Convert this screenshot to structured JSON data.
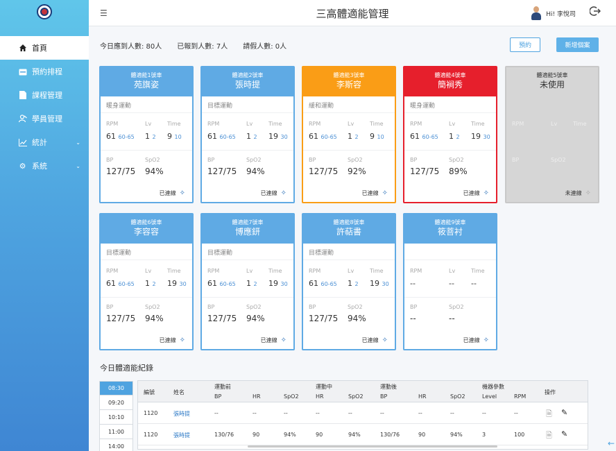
{
  "app": {
    "title": "三高體適能管理"
  },
  "user": {
    "greeting": "Hi! 李悅司"
  },
  "sidebar": {
    "items": [
      {
        "label": "首頁",
        "icon": "home-icon"
      },
      {
        "label": "預約排程",
        "icon": "calendar-icon"
      },
      {
        "label": "課程管理",
        "icon": "document-icon"
      },
      {
        "label": "學員管理",
        "icon": "users-icon"
      },
      {
        "label": "統計",
        "icon": "chart-icon"
      },
      {
        "label": "系統",
        "icon": "gear-icon"
      }
    ]
  },
  "summary": {
    "due": "今日應到人數: 80人",
    "arrived": "已報到人數: 7人",
    "leave": "請假人數: 0人"
  },
  "buttons": {
    "reserve": "預約",
    "new_record": "新增個案"
  },
  "labels": {
    "rpm": "RPM",
    "lv": "Lv",
    "time": "Time",
    "bp": "BP",
    "spo2": "SpO2"
  },
  "cards": [
    {
      "bike": "體適能1號車",
      "name": "苑旗姿",
      "mode": "暖身運動",
      "rpm": "61",
      "rpm_target": "60-65",
      "lv": "1",
      "lv_target": "2",
      "time": "9",
      "time_target": "10",
      "bp": "127/75",
      "spo2": "94%",
      "status": "已連線",
      "color": "blue"
    },
    {
      "bike": "體適能2號車",
      "name": "張時提",
      "mode": "目標運動",
      "rpm": "61",
      "rpm_target": "60-65",
      "lv": "1",
      "lv_target": "2",
      "time": "19",
      "time_target": "30",
      "bp": "127/75",
      "spo2": "94%",
      "status": "已連線",
      "color": "blue"
    },
    {
      "bike": "體適能3號車",
      "name": "李斯容",
      "mode": "緩和運動",
      "rpm": "61",
      "rpm_target": "60-65",
      "lv": "1",
      "lv_target": "2",
      "time": "9",
      "time_target": "10",
      "bp": "127/75",
      "spo2": "92%",
      "status": "已連線",
      "color": "orange"
    },
    {
      "bike": "體適能4號車",
      "name": "簡裥秀",
      "mode": "暖身運動",
      "rpm": "61",
      "rpm_target": "60-65",
      "lv": "1",
      "lv_target": "2",
      "time": "19",
      "time_target": "30",
      "bp": "127/75",
      "spo2": "89%",
      "status": "已連線",
      "color": "red"
    },
    {
      "bike": "體適能5號車",
      "name": "未使用",
      "mode": "",
      "rpm": "",
      "rpm_target": "",
      "lv": "",
      "lv_target": "",
      "time": "",
      "time_target": "",
      "bp": "",
      "spo2": "",
      "status": "未連線",
      "color": "gray"
    },
    {
      "bike": "體適能6號車",
      "name": "李容容",
      "mode": "目標運動",
      "rpm": "61",
      "rpm_target": "60-65",
      "lv": "1",
      "lv_target": "2",
      "time": "19",
      "time_target": "30",
      "bp": "127/75",
      "spo2": "94%",
      "status": "已連線",
      "color": "blue"
    },
    {
      "bike": "體適能7號車",
      "name": "博應鈃",
      "mode": "目標運動",
      "rpm": "61",
      "rpm_target": "60-65",
      "lv": "1",
      "lv_target": "2",
      "time": "19",
      "time_target": "30",
      "bp": "127/75",
      "spo2": "94%",
      "status": "已連線",
      "color": "blue"
    },
    {
      "bike": "體適能8號車",
      "name": "許萜書",
      "mode": "目標運動",
      "rpm": "61",
      "rpm_target": "60-65",
      "lv": "1",
      "lv_target": "2",
      "time": "19",
      "time_target": "30",
      "bp": "127/75",
      "spo2": "94%",
      "status": "已連線",
      "color": "blue"
    },
    {
      "bike": "體適能9號車",
      "name": "筱菩衬",
      "mode": "",
      "rpm": "--",
      "rpm_target": "",
      "lv": "--",
      "lv_target": "",
      "time": "--",
      "time_target": "",
      "bp": "--",
      "spo2": "--",
      "status": "已連線",
      "color": "blue"
    }
  ],
  "records": {
    "title": "今日體適能紀錄",
    "times": [
      "08:30",
      "09:20",
      "10:10",
      "11:00",
      "14:00"
    ],
    "groups": {
      "before": "運動前",
      "during": "運動中",
      "after": "運動後",
      "machine": "機器參數"
    },
    "columns": {
      "no": "編號",
      "name": "姓名",
      "bp": "BP",
      "hr": "HR",
      "spo2": "SpO2",
      "level": "Level",
      "rpm": "RPM",
      "ops": "操作"
    },
    "rows": [
      [
        "1120",
        "張時提",
        "--",
        "--",
        "--",
        "--",
        "--",
        "--",
        "--",
        "--",
        "--",
        "--"
      ],
      [
        "1120",
        "張時提",
        "130/76",
        "90",
        "94%",
        "90",
        "94%",
        "130/76",
        "90",
        "94%",
        "3",
        "100"
      ]
    ]
  }
}
